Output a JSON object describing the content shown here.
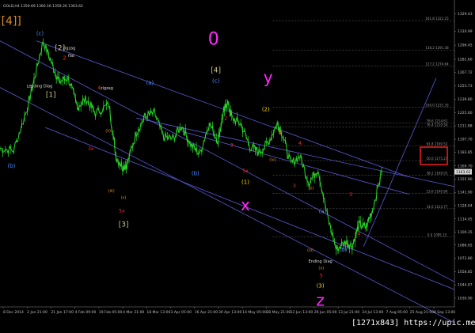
{
  "chart_data": {
    "type": "line",
    "title": "GOLD,H4",
    "header_text": "GOLD,H4  1359.69 1360.16 1359.20 1363.62",
    "symbol": "GOLD",
    "timeframe": "H4",
    "last_price": "1163.62",
    "ylim": [
      1021.7,
      1333.9
    ],
    "y_ticks": [
      "1329.43",
      "1310.99",
      "1296.45",
      "1281.60",
      "1267.72",
      "1253.73",
      "1239.80",
      "1225.60",
      "1211.88",
      "1197.70",
      "1183.85",
      "1169.70",
      "1155.90",
      "1141.90",
      "1128.04",
      "1114.05",
      "1100.35",
      "1086.65",
      "1072.80",
      "1058.85",
      "1044.87",
      "1030.90"
    ],
    "x_ticks": [
      "8 Dec 2014",
      "2 Jan 21:00",
      "21 Jan 17:00",
      "4 Feb 09:00",
      "19 Feb 05:00",
      "4 Mar 21:00",
      "18 Mar 13:00",
      "3 Apr 05:00",
      "16 Apr 21:00",
      "30 Apr 13:00",
      "14 May 05:00",
      "28 May 21:00",
      "12 Jun 13:00",
      "26 Jun 05:00",
      "13 Jul 21:00",
      "24 Jul 13:00",
      "7 Aug 05:00",
      "25 Aug 21:00",
      "8 Sep 13:00"
    ],
    "price_path": [
      {
        "t": 0.0,
        "p": 1188.0
      },
      {
        "t": 0.03,
        "p": 1186.0
      },
      {
        "t": 0.06,
        "p": 1230.0
      },
      {
        "t": 0.075,
        "p": 1260.0
      },
      {
        "t": 0.095,
        "p": 1301.0
      },
      {
        "t": 0.115,
        "p": 1276.0
      },
      {
        "t": 0.13,
        "p": 1258.0
      },
      {
        "t": 0.15,
        "p": 1262.0
      },
      {
        "t": 0.17,
        "p": 1232.0
      },
      {
        "t": 0.19,
        "p": 1240.0
      },
      {
        "t": 0.21,
        "p": 1225.0
      },
      {
        "t": 0.24,
        "p": 1234.0
      },
      {
        "t": 0.255,
        "p": 1180.0
      },
      {
        "t": 0.27,
        "p": 1168.0
      },
      {
        "t": 0.28,
        "p": 1172.0
      },
      {
        "t": 0.3,
        "p": 1205.0
      },
      {
        "t": 0.32,
        "p": 1222.0
      },
      {
        "t": 0.34,
        "p": 1225.0
      },
      {
        "t": 0.36,
        "p": 1200.0
      },
      {
        "t": 0.38,
        "p": 1198.0
      },
      {
        "t": 0.4,
        "p": 1212.0
      },
      {
        "t": 0.42,
        "p": 1192.0
      },
      {
        "t": 0.44,
        "p": 1182.0
      },
      {
        "t": 0.46,
        "p": 1215.0
      },
      {
        "t": 0.48,
        "p": 1196.0
      },
      {
        "t": 0.49,
        "p": 1222.0
      },
      {
        "t": 0.5,
        "p": 1238.0
      },
      {
        "t": 0.51,
        "p": 1220.0
      },
      {
        "t": 0.53,
        "p": 1214.0
      },
      {
        "t": 0.55,
        "p": 1190.0
      },
      {
        "t": 0.57,
        "p": 1184.0
      },
      {
        "t": 0.59,
        "p": 1194.0
      },
      {
        "t": 0.61,
        "p": 1214.0
      },
      {
        "t": 0.62,
        "p": 1205.0
      },
      {
        "t": 0.64,
        "p": 1172.0
      },
      {
        "t": 0.66,
        "p": 1180.0
      },
      {
        "t": 0.68,
        "p": 1152.0
      },
      {
        "t": 0.7,
        "p": 1167.0
      },
      {
        "t": 0.72,
        "p": 1118.0
      },
      {
        "t": 0.74,
        "p": 1082.0
      },
      {
        "t": 0.76,
        "p": 1090.0
      },
      {
        "t": 0.775,
        "p": 1086.0
      },
      {
        "t": 0.79,
        "p": 1108.0
      },
      {
        "t": 0.805,
        "p": 1105.0
      },
      {
        "t": 0.82,
        "p": 1124.0
      },
      {
        "t": 0.84,
        "p": 1164.0
      }
    ],
    "channels": [
      {
        "t1": 0.0,
        "p1": 1301.0,
        "t2": 1.0,
        "p2": 1048.0
      },
      {
        "t1": 0.0,
        "p1": 1252.0,
        "t2": 1.0,
        "p2": 1005.0
      },
      {
        "t1": 0.1,
        "p1": 1210.0,
        "t2": 1.0,
        "p2": 1040.0
      },
      {
        "t1": 0.08,
        "p1": 1301.0,
        "t2": 0.9,
        "p2": 1158.0
      },
      {
        "t1": 0.4,
        "p1": 1206.0,
        "t2": 0.9,
        "p2": 1140.0
      },
      {
        "t1": 0.3,
        "p1": 1220.0,
        "t2": 1.0,
        "p2": 1148.0
      }
    ],
    "fib_levels": [
      {
        "label": "161.8 1322.25",
        "p": 1322.2
      },
      {
        "label": "138.2 1291.38",
        "p": 1291.4
      },
      {
        "label": "127.2 1274.64",
        "p": 1274.6
      },
      {
        "label": "100.0 1231.35",
        "p": 1231.4
      },
      {
        "label": "78.6 1214.61",
        "p": 1214.6
      },
      {
        "label": "76.4 1210.50",
        "p": 1210.5
      },
      {
        "label": "61.8 1190.52",
        "p": 1190.5
      },
      {
        "label": "50.0 1175.27",
        "p": 1175.3
      },
      {
        "label": "38.2 1160.03",
        "p": 1160.0
      },
      {
        "label": "23.6 1140.90",
        "p": 1140.9
      },
      {
        "label": "14.6 1124.77",
        "p": 1124.8
      },
      {
        "label": "0.0 1095.15",
        "p": 1095.2
      }
    ],
    "annotations": [
      {
        "text": "[[4]]",
        "t": 0.02,
        "p": 1318.0,
        "color": "#e08a1e",
        "size": 14
      },
      {
        "text": "(c)",
        "t": 0.088,
        "p": 1307.0,
        "color": "#4a8cff",
        "size": 7
      },
      {
        "text": "[2]",
        "t": 0.132,
        "p": 1291.0,
        "color": "#c9c88a",
        "size": 9
      },
      {
        "text": "zigzag",
        "t": 0.152,
        "p": 1292.0,
        "color": "#dcdcdc",
        "size": 5
      },
      {
        "text": "flat",
        "t": 0.157,
        "p": 1284.0,
        "color": "#dcdcdc",
        "size": 5
      },
      {
        "text": "2",
        "t": 0.142,
        "p": 1281.0,
        "color": "#ff3030",
        "size": 7
      },
      {
        "text": "Leading Diag",
        "t": 0.087,
        "p": 1252.0,
        "color": "#dcdcdc",
        "size": 5
      },
      {
        "text": "[1]",
        "t": 0.112,
        "p": 1242.0,
        "color": "#c9c88a",
        "size": 9
      },
      {
        "text": "4",
        "t": 0.218,
        "p": 1250.0,
        "color": "#ff3030",
        "size": 6
      },
      {
        "text": "zigzag",
        "t": 0.235,
        "p": 1250.0,
        "color": "#dcdcdc",
        "size": 5
      },
      {
        "text": "3x",
        "t": 0.2,
        "p": 1186.0,
        "color": "#ff3030",
        "size": 6
      },
      {
        "text": "5x",
        "t": 0.268,
        "p": 1121.0,
        "color": "#ff3030",
        "size": 6
      },
      {
        "text": "[3]",
        "t": 0.272,
        "p": 1106.0,
        "color": "#c9c88a",
        "size": 9
      },
      {
        "text": "(a)",
        "t": 0.33,
        "p": 1255.0,
        "color": "#4a8cff",
        "size": 7
      },
      {
        "text": "(b)",
        "t": 0.43,
        "p": 1160.0,
        "color": "#4a8cff",
        "size": 7
      },
      {
        "text": "(b)",
        "t": 0.025,
        "p": 1168.0,
        "color": "#4a8cff",
        "size": 7
      },
      {
        "text": "0",
        "t": 0.47,
        "p": 1297.0,
        "color": "#ff2aff",
        "size": 22
      },
      {
        "text": "[4]",
        "t": 0.475,
        "p": 1268.0,
        "color": "#c9c88a",
        "size": 9
      },
      {
        "text": "(c)",
        "t": 0.475,
        "p": 1257.0,
        "color": "#4a8cff",
        "size": 7
      },
      {
        "text": "y",
        "t": 0.59,
        "p": 1257.0,
        "color": "#ff2aff",
        "size": 20
      },
      {
        "text": "(2)",
        "t": 0.585,
        "p": 1227.0,
        "color": "#ffd700",
        "size": 7
      },
      {
        "text": "2",
        "t": 0.497,
        "p": 1218.0,
        "color": "#ff3030",
        "size": 6
      },
      {
        "text": "5x",
        "t": 0.54,
        "p": 1163.0,
        "color": "#ff3030",
        "size": 6
      },
      {
        "text": "(1)",
        "t": 0.54,
        "p": 1151.0,
        "color": "#ffd700",
        "size": 7
      },
      {
        "text": "x",
        "t": 0.54,
        "p": 1123.0,
        "color": "#ff2aff",
        "size": 20
      },
      {
        "text": "2",
        "t": 0.617,
        "p": 1203.0,
        "color": "#ff3030",
        "size": 6
      },
      {
        "text": "3",
        "t": 0.51,
        "p": 1190.0,
        "color": "#ff3030",
        "size": 6
      },
      {
        "text": "4",
        "t": 0.66,
        "p": 1192.0,
        "color": "#ff3030",
        "size": 6
      },
      {
        "text": "3",
        "t": 0.648,
        "p": 1147.0,
        "color": "#ff3030",
        "size": 6
      },
      {
        "text": "(a)",
        "t": 0.71,
        "p": 1120.0,
        "color": "#4a8cff",
        "size": 7
      },
      {
        "text": "Ending Diag",
        "t": 0.705,
        "p": 1068.0,
        "color": "#dcdcdc",
        "size": 5
      },
      {
        "text": "(b)",
        "t": 0.755,
        "p": 1080.0,
        "color": "#4a8cff",
        "size": 7
      },
      {
        "text": "3",
        "t": 0.772,
        "p": 1138.0,
        "color": "#ff3030",
        "size": 6
      },
      {
        "text": "4",
        "t": 0.79,
        "p": 1097.0,
        "color": "#ff3030",
        "size": 6
      },
      {
        "text": "2",
        "t": 0.762,
        "p": 1087.0,
        "color": "#ff3030",
        "size": 6
      },
      {
        "text": "(3)",
        "t": 0.705,
        "p": 1042.0,
        "color": "#ffd700",
        "size": 7
      },
      {
        "text": "z",
        "t": 0.705,
        "p": 1023.0,
        "color": "#ff2aff",
        "size": 20
      },
      {
        "text": "5",
        "t": 0.707,
        "p": 1053.0,
        "color": "#ff3030",
        "size": 6
      },
      {
        "text": "(v)",
        "t": 0.707,
        "p": 1061.0,
        "color": "#e08a1e",
        "size": 5
      },
      {
        "text": "(iii)",
        "t": 0.683,
        "p": 1080.0,
        "color": "#e08a1e",
        "size": 5
      },
      {
        "text": "(v)",
        "t": 0.272,
        "p": 1135.0,
        "color": "#e08a1e",
        "size": 5
      },
      {
        "text": "(iii)",
        "t": 0.245,
        "p": 1142.0,
        "color": "#e08a1e",
        "size": 5
      },
      {
        "text": "(ii)",
        "t": 0.238,
        "p": 1205.0,
        "color": "#e08a1e",
        "size": 5
      },
      {
        "text": "(iv)",
        "t": 0.6,
        "p": 1175.0,
        "color": "#e08a1e",
        "size": 5
      },
      {
        "text": "(ii)",
        "t": 0.685,
        "p": 1145.0,
        "color": "#e08a1e",
        "size": 5
      }
    ],
    "watermark": "[1271x843] https://upic.me/"
  }
}
